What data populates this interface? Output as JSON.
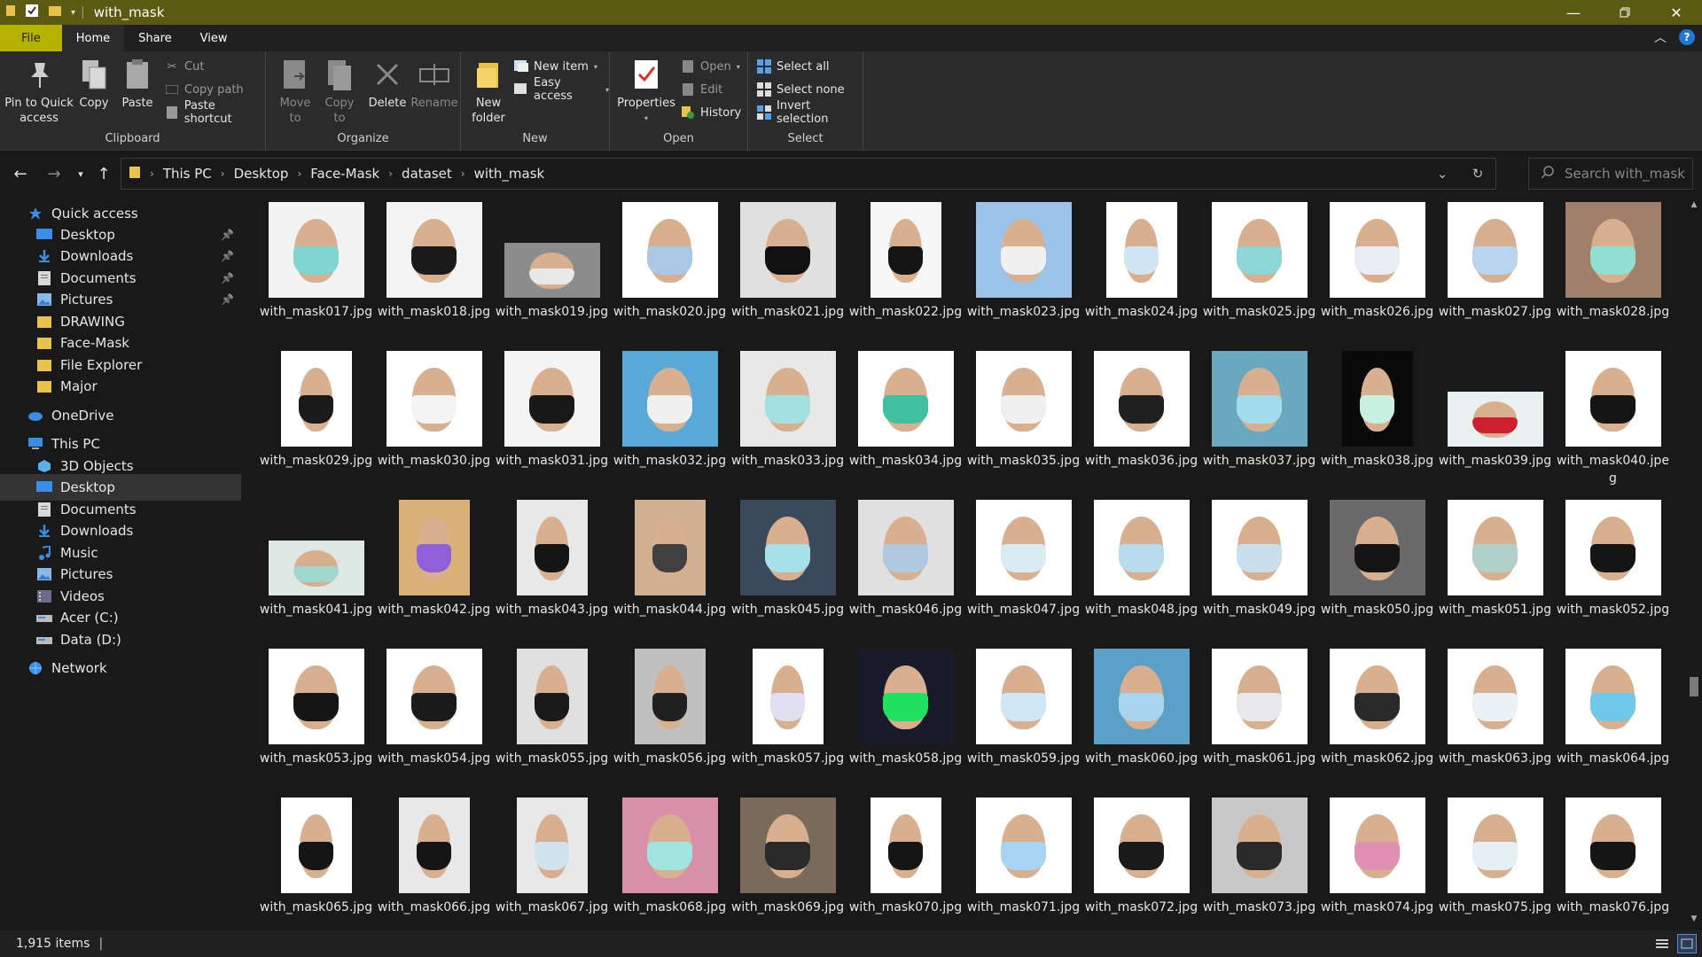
{
  "window": {
    "title": "with_mask"
  },
  "tabs": [
    "File",
    "Home",
    "Share",
    "View"
  ],
  "ribbon": {
    "clipboard": {
      "pin": "Pin to Quick access",
      "copy": "Copy",
      "paste": "Paste",
      "cut": "Cut",
      "copy_path": "Copy path",
      "paste_shortcut": "Paste shortcut",
      "group": "Clipboard"
    },
    "organize": {
      "move_to": "Move to",
      "copy_to": "Copy to",
      "delete": "Delete",
      "rename": "Rename",
      "group": "Organize"
    },
    "new": {
      "new_folder": "New folder",
      "new_item": "New item",
      "easy_access": "Easy access",
      "group": "New"
    },
    "open": {
      "properties": "Properties",
      "open": "Open",
      "edit": "Edit",
      "history": "History",
      "group": "Open"
    },
    "select": {
      "select_all": "Select all",
      "select_none": "Select none",
      "invert": "Invert selection",
      "group": "Select"
    }
  },
  "breadcrumb": [
    "This PC",
    "Desktop",
    "Face-Mask",
    "dataset",
    "with_mask"
  ],
  "search": {
    "placeholder": "Search with_mask"
  },
  "nav": [
    {
      "label": "Quick access",
      "icon": "star-icon",
      "indent": 0,
      "section": true
    },
    {
      "label": "Desktop",
      "icon": "desktop-icon",
      "indent": 1,
      "pinned": true
    },
    {
      "label": "Downloads",
      "icon": "download-icon",
      "indent": 1,
      "pinned": true
    },
    {
      "label": "Documents",
      "icon": "documents-icon",
      "indent": 1,
      "pinned": true
    },
    {
      "label": "Pictures",
      "icon": "pictures-icon",
      "indent": 1,
      "pinned": true
    },
    {
      "label": "DRAWING",
      "icon": "folder-icon",
      "indent": 1
    },
    {
      "label": "Face-Mask",
      "icon": "folder-icon",
      "indent": 1
    },
    {
      "label": "File Explorer",
      "icon": "folder-icon",
      "indent": 1
    },
    {
      "label": "Major",
      "icon": "folder-icon",
      "indent": 1
    },
    {
      "label": "OneDrive",
      "icon": "cloud-icon",
      "indent": 0,
      "section": true
    },
    {
      "label": "This PC",
      "icon": "pc-icon",
      "indent": 0,
      "section": true
    },
    {
      "label": "3D Objects",
      "icon": "3d-objects-icon",
      "indent": 1
    },
    {
      "label": "Desktop",
      "icon": "desktop-icon",
      "indent": 1,
      "selected": true
    },
    {
      "label": "Documents",
      "icon": "documents-icon",
      "indent": 1
    },
    {
      "label": "Downloads",
      "icon": "download-icon",
      "indent": 1
    },
    {
      "label": "Music",
      "icon": "music-icon",
      "indent": 1
    },
    {
      "label": "Pictures",
      "icon": "pictures-icon",
      "indent": 1
    },
    {
      "label": "Videos",
      "icon": "videos-icon",
      "indent": 1
    },
    {
      "label": "Acer (C:)",
      "icon": "drive-icon",
      "indent": 1
    },
    {
      "label": "Data (D:)",
      "icon": "drive-icon",
      "indent": 1
    },
    {
      "label": "Network",
      "icon": "network-icon",
      "indent": 0,
      "section": true
    }
  ],
  "files": [
    {
      "name": "with_mask017.jpg",
      "bg": "#f2f2f2",
      "mask": "#7fd6d0",
      "shape": "sq"
    },
    {
      "name": "with_mask018.jpg",
      "bg": "#f4f4f4",
      "mask": "#1a1a1a",
      "shape": "sq"
    },
    {
      "name": "with_mask019.jpg",
      "bg": "#8c8c8c",
      "mask": "#e8e8e8",
      "shape": "wide"
    },
    {
      "name": "with_mask020.jpg",
      "bg": "#ffffff",
      "mask": "#a8c8e6",
      "shape": "sq"
    },
    {
      "name": "with_mask021.jpg",
      "bg": "#e0e0e0",
      "mask": "#111111",
      "shape": "sq"
    },
    {
      "name": "with_mask022.jpg",
      "bg": "#f6f6f6",
      "mask": "#151515",
      "shape": "tall"
    },
    {
      "name": "with_mask023.jpg",
      "bg": "#9cc4ea",
      "mask": "#f0f0f0",
      "shape": "sq"
    },
    {
      "name": "with_mask024.jpg",
      "bg": "#ffffff",
      "mask": "#cfe6f2",
      "shape": "tall"
    },
    {
      "name": "with_mask025.jpg",
      "bg": "#ffffff",
      "mask": "#8fd6d6",
      "shape": "sq"
    },
    {
      "name": "with_mask026.jpg",
      "bg": "#ffffff",
      "mask": "#e8eef4",
      "shape": "sq"
    },
    {
      "name": "with_mask027.jpg",
      "bg": "#ffffff",
      "mask": "#b8d4ee",
      "shape": "sq"
    },
    {
      "name": "with_mask028.jpg",
      "bg": "#a0806a",
      "mask": "#8fe0d2",
      "shape": "sq"
    },
    {
      "name": "with_mask029.jpg",
      "bg": "#ffffff",
      "mask": "#1a1a1a",
      "shape": "tall"
    },
    {
      "name": "with_mask030.jpg",
      "bg": "#ffffff",
      "mask": "#f4f4f4",
      "shape": "sq"
    },
    {
      "name": "with_mask031.jpg",
      "bg": "#f4f4f4",
      "mask": "#181818",
      "shape": "sq"
    },
    {
      "name": "with_mask032.jpg",
      "bg": "#58a8d8",
      "mask": "#f0f0f0",
      "shape": "sq"
    },
    {
      "name": "with_mask033.jpg",
      "bg": "#e8e8e8",
      "mask": "#a4e0e0",
      "shape": "sq"
    },
    {
      "name": "with_mask034.jpg",
      "bg": "#ffffff",
      "mask": "#40c0a0",
      "shape": "sq"
    },
    {
      "name": "with_mask035.jpg",
      "bg": "#ffffff",
      "mask": "#f0f0f0",
      "shape": "sq"
    },
    {
      "name": "with_mask036.jpg",
      "bg": "#ffffff",
      "mask": "#202020",
      "shape": "sq"
    },
    {
      "name": "with_mask037.jpg",
      "bg": "#6aa8c0",
      "mask": "#a4dceb",
      "shape": "sq"
    },
    {
      "name": "with_mask038.jpg",
      "bg": "#0a0a0a",
      "mask": "#c8f0e0",
      "shape": "tall"
    },
    {
      "name": "with_mask039.jpg",
      "bg": "#e8f0f0",
      "mask": "#cc2030",
      "shape": "wide"
    },
    {
      "name": "with_mask040.jpeg",
      "bg": "#ffffff",
      "mask": "#151515",
      "shape": "sq"
    },
    {
      "name": "with_mask041.jpg",
      "bg": "#dde8e4",
      "mask": "#a0d8d0",
      "shape": "wide"
    },
    {
      "name": "with_mask042.jpg",
      "bg": "#d8b078",
      "mask": "#9060d8",
      "shape": "tall"
    },
    {
      "name": "with_mask043.jpg",
      "bg": "#e8e8e8",
      "mask": "#151515",
      "shape": "tall"
    },
    {
      "name": "with_mask044.jpg",
      "bg": "#d0b090",
      "mask": "#404040",
      "shape": "tall"
    },
    {
      "name": "with_mask045.jpg",
      "bg": "#3a4a5a",
      "mask": "#a8e0ea",
      "shape": "sq"
    },
    {
      "name": "with_mask046.jpg",
      "bg": "#e0e0e0",
      "mask": "#b0c8e0",
      "shape": "sq"
    },
    {
      "name": "with_mask047.jpg",
      "bg": "#ffffff",
      "mask": "#d8ecf4",
      "shape": "sq"
    },
    {
      "name": "with_mask048.jpg",
      "bg": "#ffffff",
      "mask": "#b8dcee",
      "shape": "sq"
    },
    {
      "name": "with_mask049.jpg",
      "bg": "#ffffff",
      "mask": "#c8e0ee",
      "shape": "sq"
    },
    {
      "name": "with_mask050.jpg",
      "bg": "#6a6a6a",
      "mask": "#151515",
      "shape": "sq"
    },
    {
      "name": "with_mask051.jpg",
      "bg": "#ffffff",
      "mask": "#b0d0c8",
      "shape": "sq"
    },
    {
      "name": "with_mask052.jpg",
      "bg": "#ffffff",
      "mask": "#151515",
      "shape": "sq"
    },
    {
      "name": "with_mask053.jpg",
      "bg": "#ffffff",
      "mask": "#151515",
      "shape": "sq"
    },
    {
      "name": "with_mask054.jpg",
      "bg": "#ffffff",
      "mask": "#1a1a1a",
      "shape": "sq"
    },
    {
      "name": "with_mask055.jpg",
      "bg": "#e0e0e0",
      "mask": "#1a1a1a",
      "shape": "tall"
    },
    {
      "name": "with_mask056.jpg",
      "bg": "#c0c0c0",
      "mask": "#202020",
      "shape": "tall"
    },
    {
      "name": "with_mask057.jpg",
      "bg": "#ffffff",
      "mask": "#e0e0f0",
      "shape": "tall"
    },
    {
      "name": "with_mask058.jpg",
      "bg": "#1a1a2a",
      "mask": "#20e060",
      "shape": "sq"
    },
    {
      "name": "with_mask059.jpg",
      "bg": "#ffffff",
      "mask": "#d0e8f4",
      "shape": "sq"
    },
    {
      "name": "with_mask060.jpg",
      "bg": "#5aa0c8",
      "mask": "#a8d4f0",
      "shape": "sq"
    },
    {
      "name": "with_mask061.jpg",
      "bg": "#ffffff",
      "mask": "#e8e8ec",
      "shape": "sq"
    },
    {
      "name": "with_mask062.jpg",
      "bg": "#ffffff",
      "mask": "#2a2a2a",
      "shape": "sq"
    },
    {
      "name": "with_mask063.jpg",
      "bg": "#ffffff",
      "mask": "#eaf2f8",
      "shape": "sq"
    },
    {
      "name": "with_mask064.jpg",
      "bg": "#ffffff",
      "mask": "#70c8e8",
      "shape": "sq"
    },
    {
      "name": "with_mask065.jpg",
      "bg": "#ffffff",
      "mask": "#151515",
      "shape": "tall"
    },
    {
      "name": "with_mask066.jpg",
      "bg": "#e8e8e8",
      "mask": "#151515",
      "shape": "tall"
    },
    {
      "name": "with_mask067.jpg",
      "bg": "#e8e8e8",
      "mask": "#d0e4f0",
      "shape": "tall"
    },
    {
      "name": "with_mask068.jpg",
      "bg": "#d890a8",
      "mask": "#a0e4e0",
      "shape": "sq"
    },
    {
      "name": "with_mask069.jpg",
      "bg": "#7a6a5a",
      "mask": "#2a2a2a",
      "shape": "sq"
    },
    {
      "name": "with_mask070.jpg",
      "bg": "#ffffff",
      "mask": "#151515",
      "shape": "tall"
    },
    {
      "name": "with_mask071.jpg",
      "bg": "#ffffff",
      "mask": "#a8d4f4",
      "shape": "sq"
    },
    {
      "name": "with_mask072.jpg",
      "bg": "#ffffff",
      "mask": "#1a1a1a",
      "shape": "sq"
    },
    {
      "name": "with_mask073.jpg",
      "bg": "#c8c8c8",
      "mask": "#2a2a2a",
      "shape": "sq"
    },
    {
      "name": "with_mask074.jpg",
      "bg": "#ffffff",
      "mask": "#e090b0",
      "shape": "sq"
    },
    {
      "name": "with_mask075.jpg",
      "bg": "#ffffff",
      "mask": "#e4f0f4",
      "shape": "sq"
    },
    {
      "name": "with_mask076.jpg",
      "bg": "#ffffff",
      "mask": "#151515",
      "shape": "sq"
    }
  ],
  "status": {
    "count": "1,915 items"
  }
}
